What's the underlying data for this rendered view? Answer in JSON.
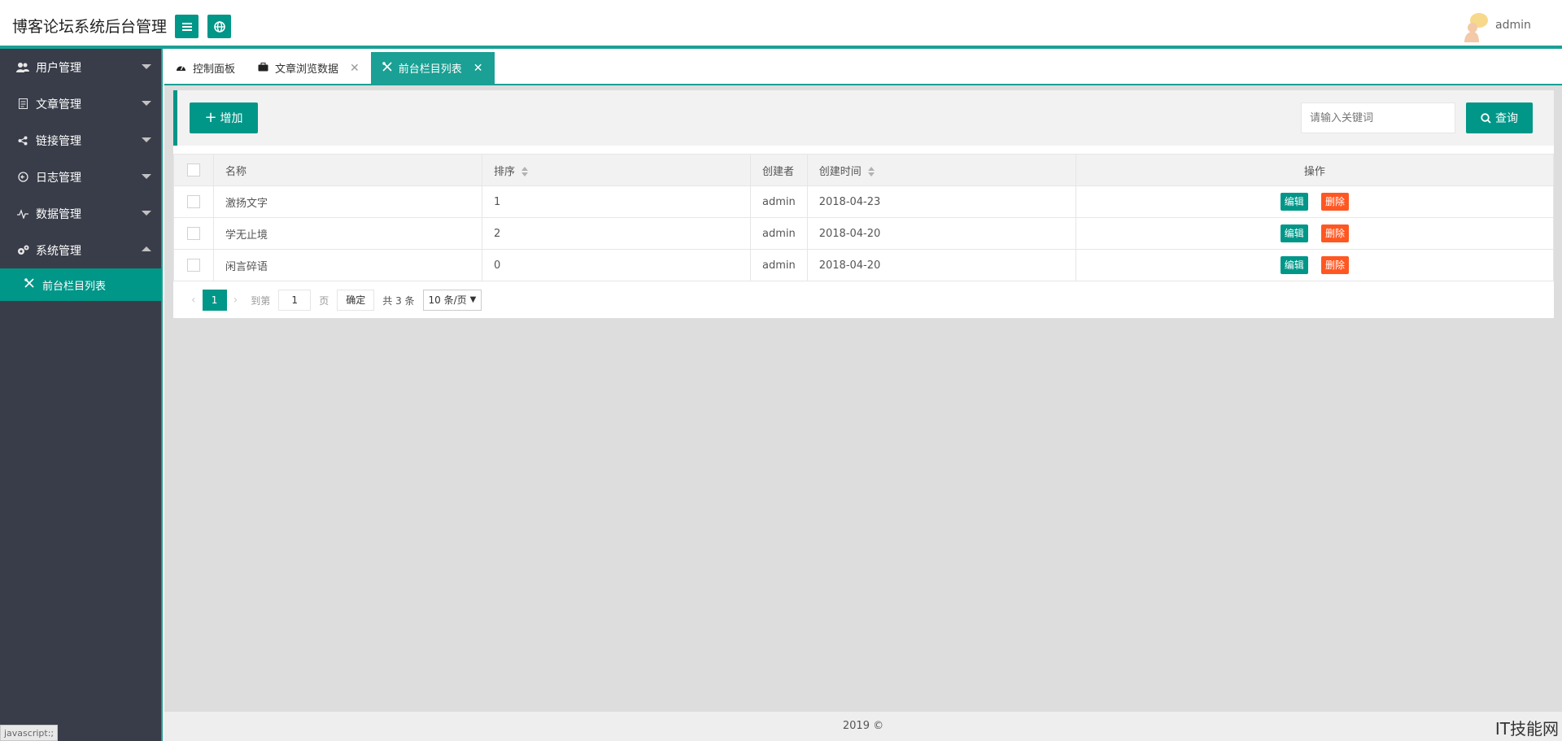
{
  "header": {
    "title": "博客论坛系统后台管理",
    "user": "admin"
  },
  "sidebar": {
    "items": [
      {
        "label": "用户管理"
      },
      {
        "label": "文章管理"
      },
      {
        "label": "链接管理"
      },
      {
        "label": "日志管理"
      },
      {
        "label": "数据管理"
      },
      {
        "label": "系统管理"
      }
    ],
    "sub_item": "前台栏目列表",
    "status": "javascript:;"
  },
  "tabs": [
    {
      "label": "控制面板"
    },
    {
      "label": "文章浏览数据"
    },
    {
      "label": "前台栏目列表"
    }
  ],
  "toolbar": {
    "add_label": "增加",
    "search_placeholder": "请输入关键词",
    "search_label": "查询"
  },
  "table": {
    "columns": [
      "名称",
      "排序",
      "创建者",
      "创建时间",
      "操作"
    ],
    "rows": [
      {
        "name": "激扬文字",
        "sort": "1",
        "creator": "admin",
        "time": "2018-04-23"
      },
      {
        "name": "学无止境",
        "sort": "2",
        "creator": "admin",
        "time": "2018-04-20"
      },
      {
        "name": "闲言碎语",
        "sort": "0",
        "creator": "admin",
        "time": "2018-04-20"
      }
    ],
    "edit_label": "编辑",
    "delete_label": "删除"
  },
  "pager": {
    "current": "1",
    "goto_label": "到第",
    "goto_value": "1",
    "page_label": "页",
    "ok_label": "确定",
    "total": "共 3 条",
    "per_page": "10 条/页"
  },
  "footer": {
    "text": "2019 ©",
    "watermark": "IT技能网"
  },
  "colors": {
    "accent": "#009688",
    "accent_light": "#1aa094",
    "danger": "#ff5722",
    "sidebar_bg": "#393d49"
  }
}
